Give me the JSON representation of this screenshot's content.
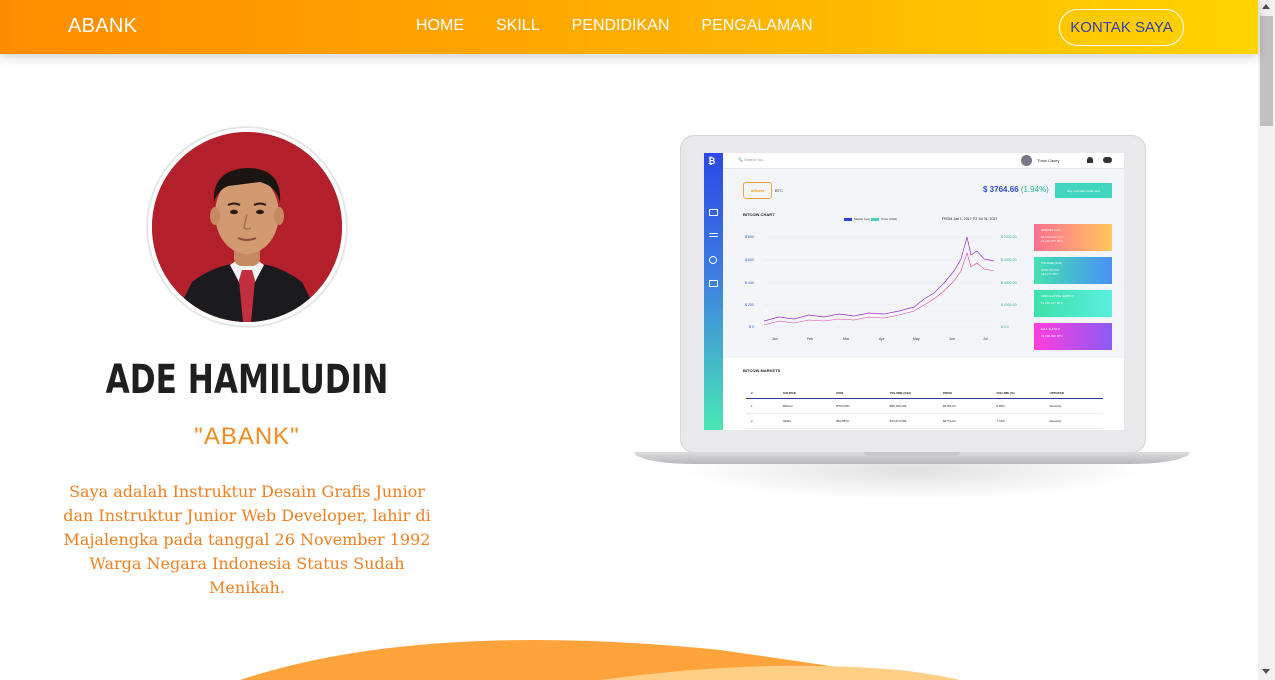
{
  "navbar": {
    "brand": "ABANK",
    "links": [
      "HOME",
      "SKILL",
      "PENDIDIKAN",
      "PENGALAMAN"
    ],
    "contact_label": "KONTAK SAYA",
    "gradient_colors": [
      "#ff8c00",
      "#ffd400"
    ]
  },
  "profile": {
    "name": "ADE HAMILUDIN",
    "nickname": "\"ABANK\"",
    "bio": "Saya adalah Instruktur Desain Grafis Junior dan Instruktur Junior Web Developer, lahir di Majalengka pada tanggal 26 November 1992 Warga Negara Indonesia Status Sudah Menikah.",
    "accent_color": "#f58b20"
  },
  "laptop_screen": {
    "search_placeholder": "Search for...",
    "user_name": "Thain Casey",
    "coin_label": "bitcoin",
    "coin_symbol": "BTC",
    "price": "$ 3764.66",
    "price_change": "(1.94%)",
    "cta_label": "Buy now with credit card",
    "chart_title": "BITCOIN CHART",
    "legend": [
      "Market Cap",
      "Price (USD)"
    ],
    "date_range": "FROM  Jan 1, 2017  TO  Jul 31, 2017",
    "y_labels_left": [
      "$ 800",
      "$ 600",
      "$ 400",
      "$ 200",
      "$ 0"
    ],
    "y_labels_right": [
      "$ 2200.00",
      "$ 4000.00",
      "$ 4000.00",
      "$ 2000.00",
      "$ 0.0"
    ],
    "x_labels": [
      "Jan",
      "Feb",
      "Mar",
      "Apr",
      "May",
      "Jun",
      "Jul"
    ],
    "cards": [
      {
        "title": "MARKET CAP",
        "value": "$62,441,137,217",
        "sub": "16,294,207 BTC"
      },
      {
        "title": "VOLUME (24H)",
        "value": "$759,792,000",
        "sub": "249,371 BTC"
      },
      {
        "title": "CIRCULATING SUPPLY",
        "value": "16,294,207 BTC",
        "sub": ""
      },
      {
        "title": "MAX SUPPLY",
        "value": "21,000,000 BTC",
        "sub": ""
      }
    ],
    "markets_title": "BITCOIN MARKETS",
    "table_headers": [
      "#",
      "SOURCE",
      "PAIR",
      "VOLUME (24H)",
      "PRICE",
      "VOLUME (%)",
      "UPDATED"
    ],
    "table_rows": [
      [
        "1",
        "Bitfinex",
        "BTC/USD",
        "$80,795,209",
        "$3763.04",
        "8.66%",
        "Recently"
      ],
      [
        "2",
        "GDEx",
        "BKC/BTC",
        "$72,673,009",
        "$3772.04",
        "7.73%",
        "Recently"
      ]
    ]
  }
}
